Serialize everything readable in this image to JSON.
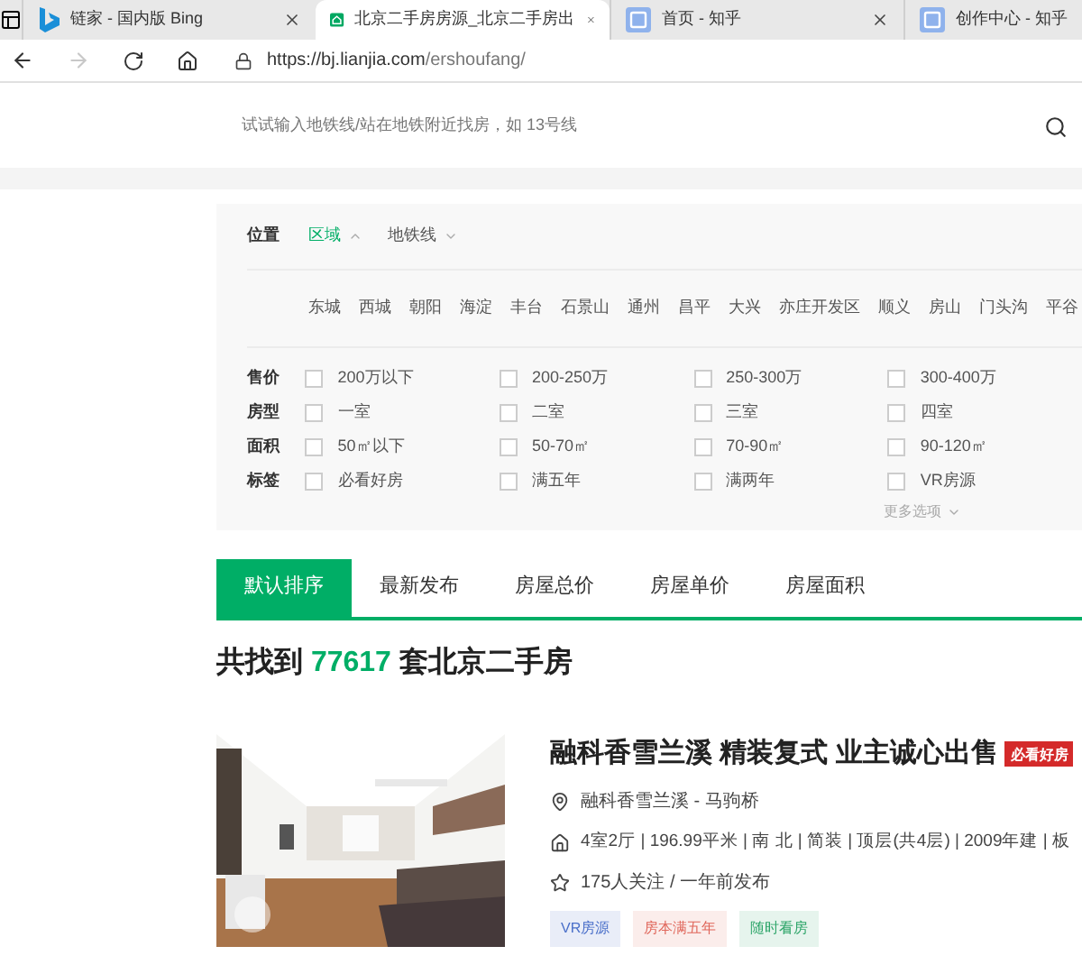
{
  "browser": {
    "tabs": [
      {
        "title": "链家 - 国内版 Bing",
        "kind": "bing",
        "selected": false
      },
      {
        "title": "北京二手房房源_北京二手房出",
        "kind": "house",
        "selected": true
      },
      {
        "title": "首页 - 知乎",
        "kind": "zhihu",
        "selected": false
      },
      {
        "title": "创作中心 - 知乎",
        "kind": "zhihu",
        "selected": false
      }
    ],
    "url": {
      "host": "https://bj.lianjia.com",
      "path": "/ershoufang/"
    }
  },
  "search": {
    "placeholder": "试试输入地铁线/站在地铁附近找房，如 13号线"
  },
  "filters": {
    "location": {
      "label": "位置",
      "modes": [
        {
          "label": "区域",
          "selected": true
        },
        {
          "label": "地铁线",
          "selected": false
        }
      ],
      "districts": [
        "东城",
        "西城",
        "朝阳",
        "海淀",
        "丰台",
        "石景山",
        "通州",
        "昌平",
        "大兴",
        "亦庄开发区",
        "顺义",
        "房山",
        "门头沟",
        "平谷"
      ]
    },
    "groups": [
      {
        "label": "售价",
        "options": [
          {
            "label": "200万以下",
            "checked": false
          },
          {
            "label": "200-250万",
            "checked": false
          },
          {
            "label": "250-300万",
            "checked": false
          },
          {
            "label": "300-400万",
            "checked": false
          }
        ]
      },
      {
        "label": "房型",
        "options": [
          {
            "label": "一室",
            "checked": false
          },
          {
            "label": "二室",
            "checked": false
          },
          {
            "label": "三室",
            "checked": false
          },
          {
            "label": "四室",
            "checked": false
          }
        ]
      },
      {
        "label": "面积",
        "options": [
          {
            "label": "50㎡以下",
            "checked": false
          },
          {
            "label": "50-70㎡",
            "checked": false
          },
          {
            "label": "70-90㎡",
            "checked": false
          },
          {
            "label": "90-120㎡",
            "checked": false
          }
        ]
      },
      {
        "label": "标签",
        "options": [
          {
            "label": "必看好房",
            "checked": false
          },
          {
            "label": "满五年",
            "checked": false
          },
          {
            "label": "满两年",
            "checked": false
          },
          {
            "label": "VR房源",
            "checked": false
          }
        ]
      }
    ],
    "more": "更多选项"
  },
  "sort_tabs": [
    {
      "label": "默认排序",
      "selected": true
    },
    {
      "label": "最新发布",
      "selected": false
    },
    {
      "label": "房屋总价",
      "selected": false
    },
    {
      "label": "房屋单价",
      "selected": false
    },
    {
      "label": "房屋面积",
      "selected": false
    }
  ],
  "result": {
    "prefix": "共找到",
    "count": "77617",
    "suffix": "套北京二手房"
  },
  "listing": {
    "title": "融科香雪兰溪 精装复式 业主诚心出售",
    "badge": "必看好房",
    "location": "融科香雪兰溪 - 马驹桥",
    "details": "4室2厅 | 196.99平米 | 南 北 | 简装 | 顶层(共4层) | 2009年建 | 板",
    "follow": "175人关注 / 一年前发布",
    "tags": [
      {
        "label": "VR房源",
        "color": "#4a6fc9"
      },
      {
        "label": "房本满五年",
        "color": "#e0685c"
      },
      {
        "label": "随时看房",
        "color": "#2ea56a"
      }
    ]
  }
}
